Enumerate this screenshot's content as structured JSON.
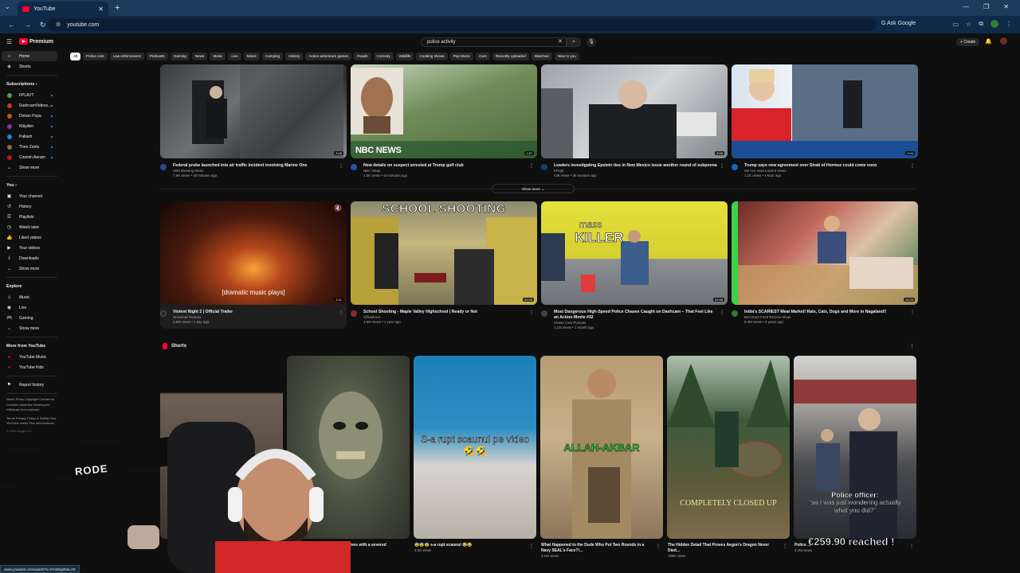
{
  "browser": {
    "tab_title": "YouTube",
    "url": "youtube.com",
    "ask_google": "Ask Google",
    "status_url": "www.youtube.com/watch?v=FmM2giDwLAE"
  },
  "masthead": {
    "logo_text": "Premium",
    "search_value": "police activity",
    "create_label": "Create"
  },
  "chips": [
    "All",
    "Police cars",
    "Law enforcement",
    "Podcasts",
    "Gaming",
    "News",
    "Music",
    "Live",
    "Mixes",
    "Camping",
    "History",
    "Action-adventure games",
    "Roads",
    "Comedy",
    "Wildlife",
    "Cooking shows",
    "Pop Music",
    "Cars",
    "Recently uploaded",
    "Watched",
    "New to you"
  ],
  "sidebar": {
    "main": [
      "Home",
      "Shorts"
    ],
    "subscriptions_title": "Subscriptions",
    "subscriptions": [
      {
        "name": "FPLAYT",
        "color": "#3aa655"
      },
      {
        "name": "DashcamVideos...",
        "color": "#c0392b"
      },
      {
        "name": "Dorian Popa",
        "color": "#d35400"
      },
      {
        "name": "Kläyden",
        "color": "#7f3b9a"
      },
      {
        "name": "Pallash",
        "color": "#1e88e5"
      },
      {
        "name": "Theo Zeelu",
        "color": "#8e6e3e"
      },
      {
        "name": "Cosmin Aeram",
        "color": "#b71c1c"
      }
    ],
    "show_more": "Show more",
    "you_title": "You",
    "you_items": [
      "Your channel",
      "History",
      "Playlists",
      "Watch later",
      "Liked videos",
      "Your videos",
      "Downloads",
      "Show more"
    ],
    "explore_title": "Explore",
    "explore_items": [
      "Music",
      "Live",
      "Gaming",
      "Show more"
    ],
    "more_title": "More from YouTube",
    "more_items": [
      "YouTube Music",
      "YouTube Kids"
    ],
    "report": "Report history",
    "footer1": "About  Press  Copyright  Contact us  Creators  Advertise  Developers  Withdraw from contract",
    "footer2": "Terms  Privacy  Policy & Safety  How YouTube works  Test new features",
    "copyright": "© 2026 Google LLC"
  },
  "row1": [
    {
      "title": "Federal probe launched into air traffic incident involving Marine One",
      "channel": "CBS Evening News",
      "stats": "7.6K views • 48 minutes ago",
      "duration": "3:45",
      "avatar": "#1f4b8f"
    },
    {
      "title": "New details on suspect arrested at Trump golf club",
      "channel": "NBC News",
      "stats": "2.5K views • 44 minutes ago",
      "duration": "1:57",
      "avatar": "#2453a5",
      "overlay": "NBC NEWS"
    },
    {
      "title": "Leaders investigating Epstein ties in New Mexico issue another round of subpoenas",
      "channel": "KRQE",
      "stats": "436 views • 35 minutes ago",
      "duration": "3:06",
      "avatar": "#203a6b"
    },
    {
      "title": "Trump says new agreement over Strait of Hormuz could come soon",
      "channel": "We Are Iowa Local 5 News",
      "stats": "1.1K views • 1 hour ago",
      "duration": "1:04",
      "avatar": "#1565c0"
    }
  ],
  "show_more": "Show more",
  "row2": [
    {
      "title": "Violent Night 2 | Official Trailer",
      "channel": "Universal Pictures",
      "stats": "3.9M views • 1 day ago",
      "duration": "2:21",
      "avatar": "#2a2a2a",
      "caption": "[dramatic music plays]"
    },
    {
      "title": "School Shooting - Maple Valley Highschool | Ready or Not",
      "channel": "Officialmoz",
      "stats": "4.9M views • 1 year ago",
      "duration": "22:05",
      "avatar": "#8a2b2b",
      "overlay": "SCHOOL SHOOTING"
    },
    {
      "title": "Most Dangerous High-Speed Police Chases Caught on Dashcam – That Feel Like an Action Movie #32",
      "channel": "Chase Cam Pursuits",
      "stats": "1.1M views • 1 month ago",
      "duration": "31:08",
      "avatar": "#444",
      "overlay1": "mass",
      "overlay2": "KILLER"
    },
    {
      "title": "India's SCARIEST Meat Market! Rats, Cats, Dogs and More in Nagaland!!",
      "channel": "Best Ever Food Review Show",
      "stats": "6.3M views • 3 years ago",
      "duration": "24:23",
      "avatar": "#2e7d32"
    }
  ],
  "shorts_title": "Shorts",
  "shorts": [
    {
      "title": "",
      "views": ""
    },
    {
      "title": "... arrives with a severed",
      "views": ""
    },
    {
      "title": "😨😨😨 s-a rupt scaunul 😂😂",
      "views": "2.2K views",
      "overlay": "S-a rupt scaunul pe video 🤣🤣"
    },
    {
      "title": "What Happened to the Dude Who Put Two Rounds in a Navy SEAL's Face?!...",
      "views": "3.1M views",
      "overlay": "ALLAH-AKBAR"
    },
    {
      "title": "The Hidden Detail That Proves Aegon's Dragon Never Died...",
      "views": "785K views",
      "overlay": "COMPLETELY CLOSED UP"
    },
    {
      "title": "Police ...",
      "views": "3.4M views",
      "overlay1": "Police officer:",
      "overlay2": "\"so I was just wondering actually what you did?\"",
      "donation": "€259.90 reached !"
    }
  ],
  "webcam_brand": "RODE"
}
